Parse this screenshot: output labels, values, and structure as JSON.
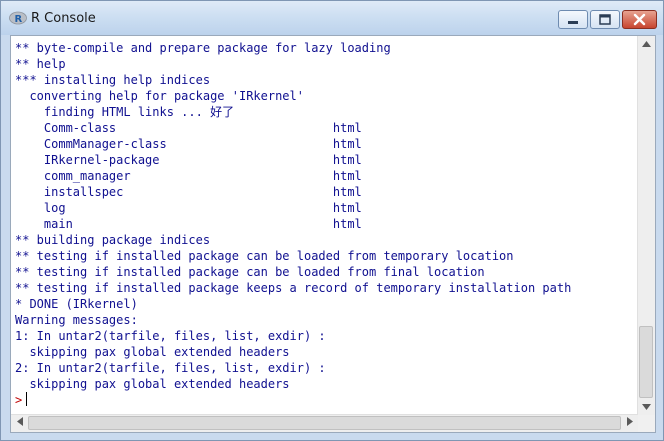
{
  "window": {
    "title": "R Console",
    "accent": "#bcd2ec"
  },
  "console": {
    "lines": [
      "** byte-compile and prepare package for lazy loading",
      "** help",
      "*** installing help indices",
      "  converting help for package 'IRkernel'",
      "    finding HTML links ... 好了",
      "    Comm-class                              html",
      "    CommManager-class                       html",
      "    IRkernel-package                        html",
      "    comm_manager                            html",
      "    installspec                             html",
      "    log                                     html",
      "    main                                    html",
      "** building package indices",
      "** testing if installed package can be loaded from temporary location",
      "** testing if installed package can be loaded from final location",
      "** testing if installed package keeps a record of temporary installation path",
      "* DONE (IRkernel)",
      "Warning messages:",
      "1: In untar2(tarfile, files, list, exdir) :",
      "  skipping pax global extended headers",
      "2: In untar2(tarfile, files, list, exdir) :",
      "  skipping pax global extended headers"
    ],
    "prompt": ">",
    "text_color": "#101090",
    "prompt_color": "#c00000"
  }
}
